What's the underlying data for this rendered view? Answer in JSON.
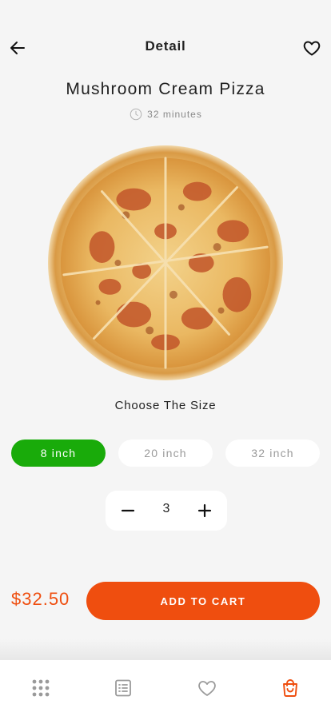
{
  "header": {
    "title": "Detail",
    "back_icon": "arrow-left-icon",
    "favorite_icon": "heart-outline-icon"
  },
  "product": {
    "name": "Mushroom Cream Pizza",
    "prep_time": "32 minutes",
    "time_icon": "clock-icon",
    "image": "pizza-image"
  },
  "size_selector": {
    "title": "Choose The Size",
    "options": [
      {
        "label": "8 inch",
        "selected": true
      },
      {
        "label": "20 inch",
        "selected": false
      },
      {
        "label": "32 inch",
        "selected": false
      }
    ]
  },
  "quantity": {
    "value": "3",
    "minus_icon": "minus-icon",
    "plus_icon": "plus-icon"
  },
  "checkout": {
    "price": "$32.50",
    "add_to_cart_label": "ADD TO CART"
  },
  "bottom_nav": {
    "items": [
      {
        "icon": "grid-dots-icon",
        "active": false
      },
      {
        "icon": "list-icon",
        "active": false
      },
      {
        "icon": "heart-icon",
        "active": false
      },
      {
        "icon": "shopping-bag-icon",
        "active": true
      }
    ]
  },
  "colors": {
    "accent": "#ef4e0f",
    "selected_size": "#19ab0a",
    "background": "#f5f5f5",
    "muted_text": "#9a9a9a"
  }
}
